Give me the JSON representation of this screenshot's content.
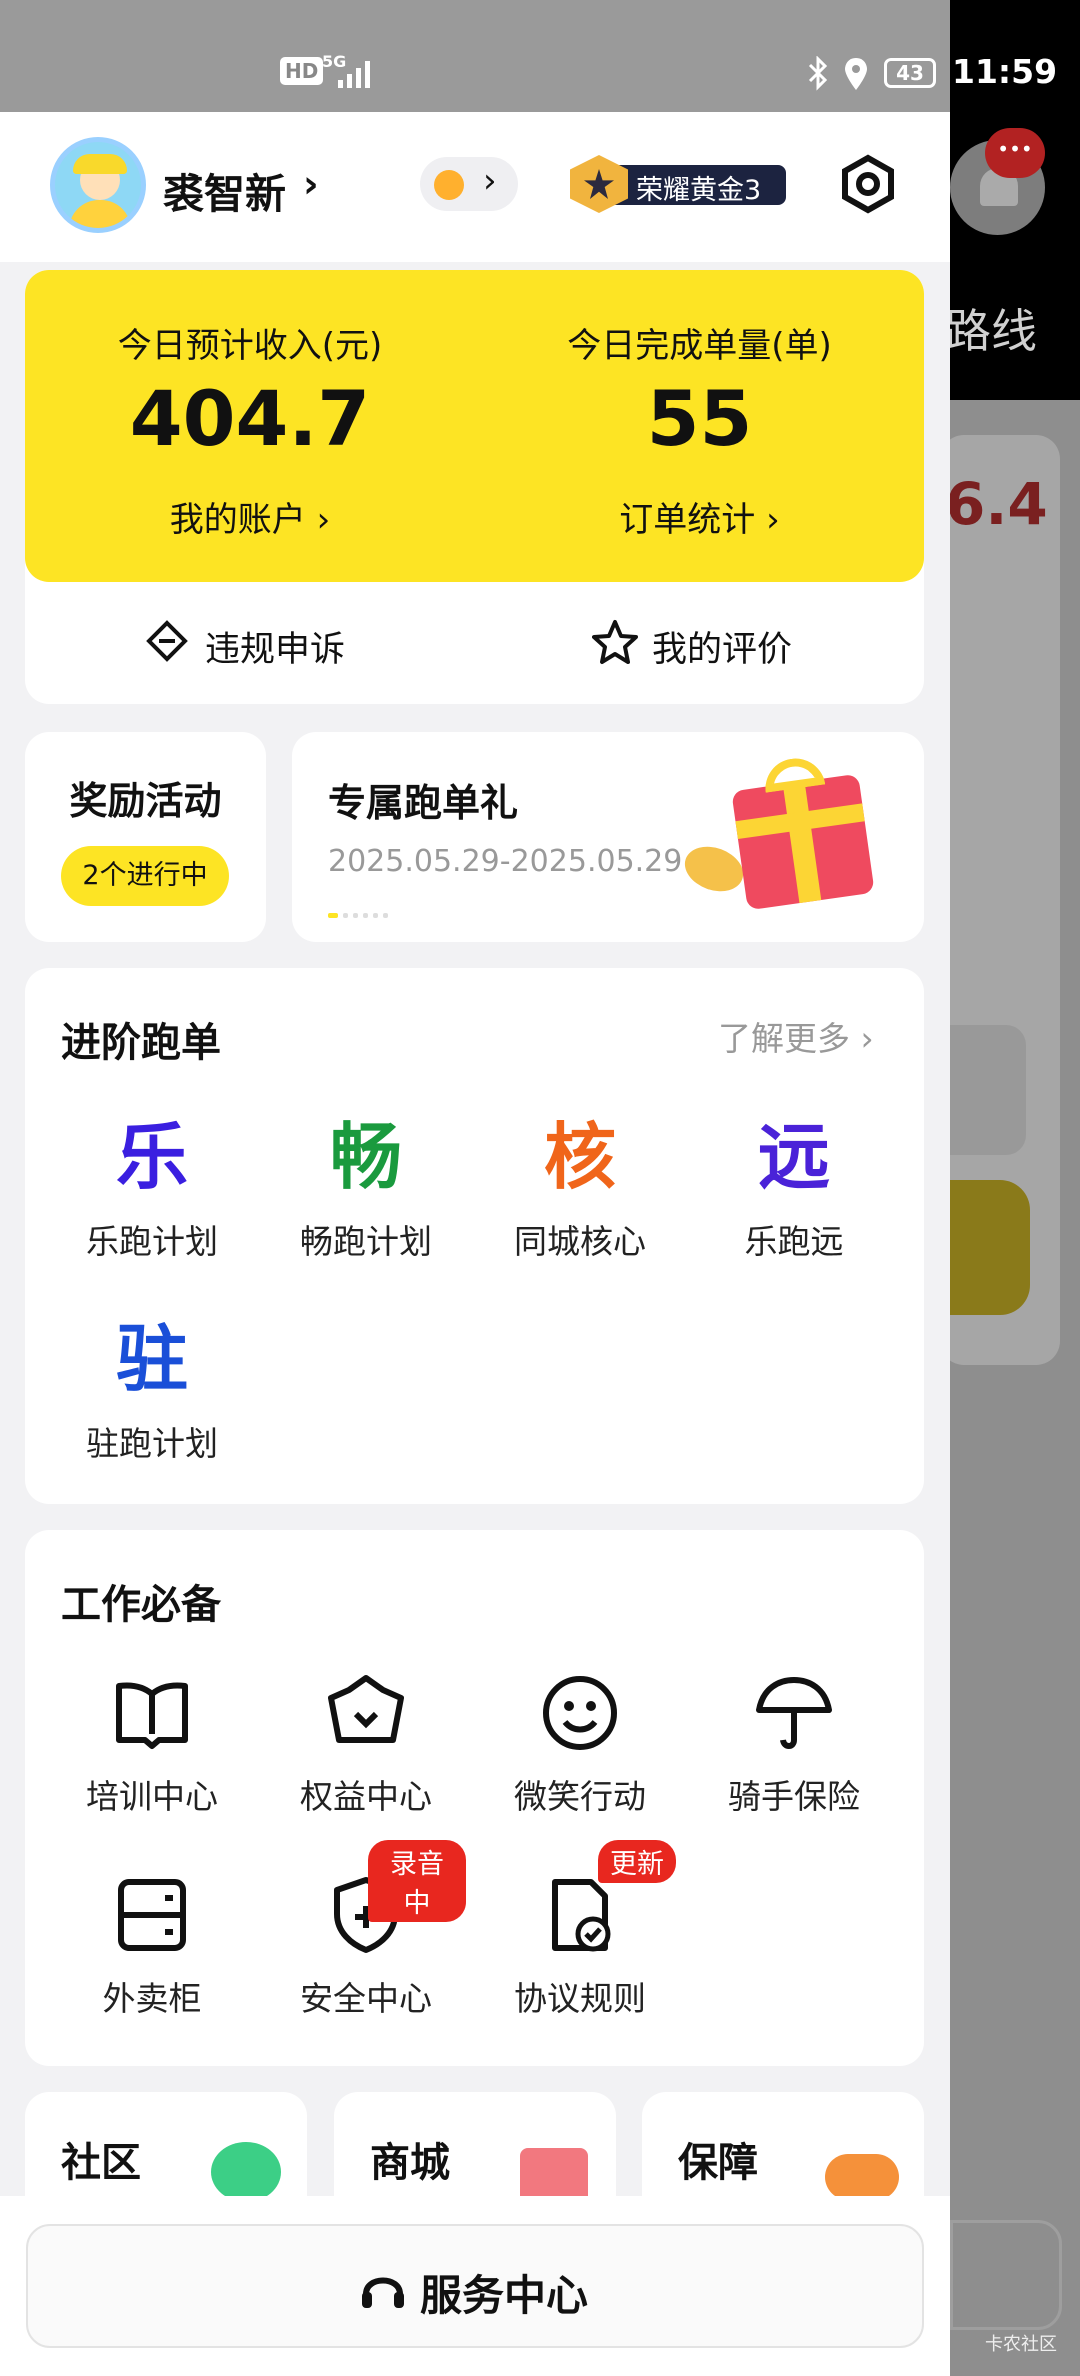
{
  "status_bar": {
    "hd": "HD",
    "network": "5G",
    "battery": "43",
    "time": "11:59"
  },
  "profile": {
    "name": "裘智新",
    "rank_badge": "荣耀黄金3"
  },
  "summary": {
    "income_label": "今日预计收入(元)",
    "income_value": "404.7",
    "account_link": "我的账户",
    "orders_label": "今日完成单量(单)",
    "orders_value": "55",
    "stats_link": "订单统计"
  },
  "actions": {
    "appeal": "违规申诉",
    "rating": "我的评价"
  },
  "rewards": {
    "title": "奖励活动",
    "badge": "2个进行中"
  },
  "promo": {
    "title": "专属跑单礼",
    "date_range": "2025.05.29-2025.05.29"
  },
  "advanced": {
    "title": "进阶跑单",
    "more": "了解更多",
    "items": [
      {
        "char": "乐",
        "label": "乐跑计划",
        "color": "#3a1fe0"
      },
      {
        "char": "畅",
        "label": "畅跑计划",
        "color": "#1a9a3e"
      },
      {
        "char": "核",
        "label": "同城核心",
        "color": "#f0651a"
      },
      {
        "char": "远",
        "label": "乐跑远",
        "color": "#4a22d8"
      },
      {
        "char": "驻",
        "label": "驻跑计划",
        "color": "#1a4fd8"
      }
    ]
  },
  "tools": {
    "title": "工作必备",
    "items": [
      {
        "label": "培训中心",
        "icon": "book-icon"
      },
      {
        "label": "权益中心",
        "icon": "crown-icon"
      },
      {
        "label": "微笑行动",
        "icon": "smile-icon"
      },
      {
        "label": "骑手保险",
        "icon": "umbrella-icon"
      },
      {
        "label": "外卖柜",
        "icon": "locker-icon"
      },
      {
        "label": "安全中心",
        "icon": "shield-icon",
        "tag": "录音中"
      },
      {
        "label": "协议规则",
        "icon": "document-check-icon",
        "tag": "更新"
      }
    ]
  },
  "bottom_cards": [
    {
      "title": "社区"
    },
    {
      "title": "商城"
    },
    {
      "title": "保障"
    }
  ],
  "service": {
    "label": "服务中心"
  },
  "background": {
    "route_text": "路线",
    "amount_fragment": "6.4"
  },
  "watermark": "卡农社区",
  "colors": {
    "accent_yellow": "#fde424",
    "tag_red": "#e8271f"
  }
}
